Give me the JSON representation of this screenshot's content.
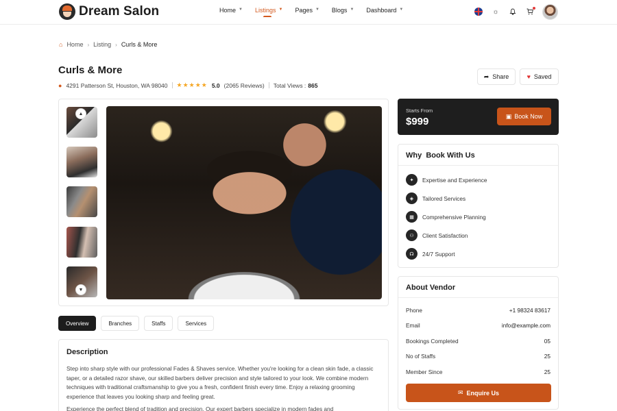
{
  "header": {
    "logo_text": "Dream Salon",
    "nav": [
      {
        "label": "Home"
      },
      {
        "label": "Listings"
      },
      {
        "label": "Pages"
      },
      {
        "label": "Blogs"
      },
      {
        "label": "Dashboard"
      }
    ],
    "active_nav": "Listings",
    "icons": [
      "flag-uk-icon",
      "sun-icon",
      "bell-icon",
      "cart-icon"
    ],
    "accent_color": "#d35a1f"
  },
  "breadcrumb": {
    "home": "Home",
    "listing": "Listing",
    "current": "Curls & More"
  },
  "listing": {
    "title": "Curls & More",
    "address": "4291 Patterson St, Houston, WA 98040",
    "rating": "5.0",
    "reviews": "(2065 Reviews)",
    "stars_filled": 5,
    "views_label": "Total Views :",
    "views_value": "865",
    "share_label": "Share",
    "saved_label": "Saved"
  },
  "gallery": {
    "thumbnails": 5,
    "main_image_icon": "barber-photo"
  },
  "tabs": [
    {
      "label": "Overview",
      "active": true
    },
    {
      "label": "Branches",
      "active": false
    },
    {
      "label": "Staffs",
      "active": false
    },
    {
      "label": "Services",
      "active": false
    }
  ],
  "description": {
    "title": "Description",
    "paragraph1": "Step into sharp style with our professional Fades & Shaves service. Whether you're looking for a clean skin fade, a classic taper, or a detailed razor shave, our skilled barbers deliver precision and style tailored to your look. We combine modern techniques with traditional craftsmanship to give you a fresh, confident finish every time. Enjoy a relaxing grooming experience that leaves you looking sharp and feeling great.",
    "paragraph2": "Experience the perfect blend of tradition and precision. Our expert barbers specialize in modern fades and"
  },
  "booking": {
    "starts_from": "Starts From",
    "price": "$999",
    "button": "Book Now"
  },
  "why": {
    "title": "Why  Book With Us",
    "items": [
      {
        "label": "Expertise and Experience",
        "icon": "bulb-icon"
      },
      {
        "label": "Tailored Services",
        "icon": "tag-icon"
      },
      {
        "label": "Comprehensive Planning",
        "icon": "grid-icon"
      },
      {
        "label": "Client Satisfaction",
        "icon": "users-icon"
      },
      {
        "label": "24/7 Support",
        "icon": "headset-icon"
      }
    ]
  },
  "vendor": {
    "title": "About Vendor",
    "rows": [
      {
        "label": "Phone",
        "value": "+1 98324 83617"
      },
      {
        "label": "Email",
        "value": "info@example.com"
      },
      {
        "label": "Bookings Completed",
        "value": "05"
      },
      {
        "label": "No of Staffs",
        "value": "25"
      },
      {
        "label": "Member Since",
        "value": "25"
      }
    ],
    "button": "Enquire Us"
  }
}
